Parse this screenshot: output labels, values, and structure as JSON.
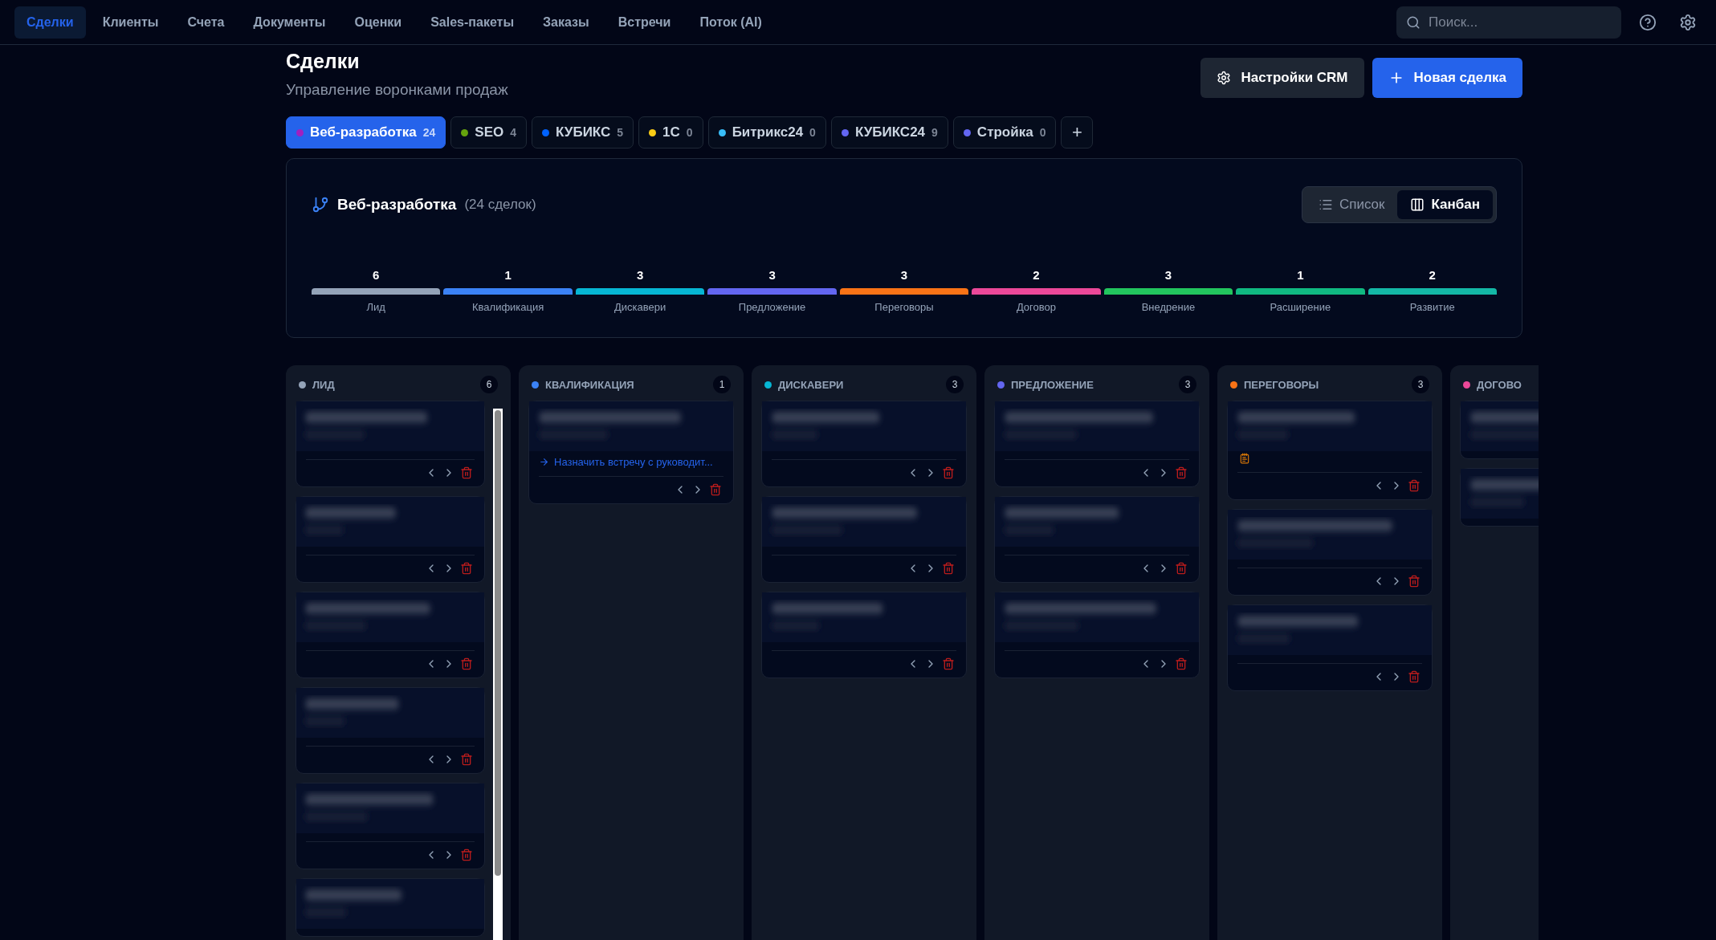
{
  "nav": {
    "items": [
      {
        "label": "Сделки",
        "selected": true
      },
      {
        "label": "Клиенты",
        "selected": false
      },
      {
        "label": "Счета",
        "selected": false
      },
      {
        "label": "Документы",
        "selected": false
      },
      {
        "label": "Оценки",
        "selected": false
      },
      {
        "label": "Sales-пакеты",
        "selected": false
      },
      {
        "label": "Заказы",
        "selected": false
      },
      {
        "label": "Встречи",
        "selected": false
      },
      {
        "label": "Поток (AI)",
        "selected": false
      }
    ],
    "search": {
      "placeholder": "Поиск..."
    }
  },
  "header": {
    "title": "Сделки",
    "subtitle": "Управление воронками продаж",
    "settings_button": "Настройки CRM",
    "new_button": "Новая сделка"
  },
  "pipelines": [
    {
      "label": "Веб-разработка",
      "count": "24",
      "color": "#a020c0",
      "selected": true
    },
    {
      "label": "SEO",
      "count": "4",
      "color": "#65a30d",
      "selected": false
    },
    {
      "label": "КУБИКС",
      "count": "5",
      "color": "#0062ff",
      "selected": false
    },
    {
      "label": "1С",
      "count": "0",
      "color": "#facc15",
      "selected": false
    },
    {
      "label": "Битрикс24",
      "count": "0",
      "color": "#38bdf8",
      "selected": false
    },
    {
      "label": "КУБИКС24",
      "count": "9",
      "color": "#6366f1",
      "selected": false
    },
    {
      "label": "Стройка",
      "count": "0",
      "color": "#6366f1",
      "selected": false
    }
  ],
  "add_pipeline": "+",
  "panel": {
    "title": "Веб-разработка",
    "subtitle": "(24 сделок)",
    "views": [
      {
        "label": "Список",
        "kind": "list",
        "selected": false
      },
      {
        "label": "Канбан",
        "kind": "kanban",
        "selected": true
      }
    ],
    "stages": [
      {
        "count": "6",
        "label": "Лид",
        "color": "#94a3b8"
      },
      {
        "count": "1",
        "label": "Квалификация",
        "color": "#3b82f6"
      },
      {
        "count": "3",
        "label": "Дискавери",
        "color": "#06b6d4"
      },
      {
        "count": "3",
        "label": "Предложение",
        "color": "#6366f1"
      },
      {
        "count": "3",
        "label": "Переговоры",
        "color": "#f97316"
      },
      {
        "count": "2",
        "label": "Договор",
        "color": "#ec4899"
      },
      {
        "count": "3",
        "label": "Внедрение",
        "color": "#22c55e"
      },
      {
        "count": "1",
        "label": "Расширение",
        "color": "#10b981"
      },
      {
        "count": "2",
        "label": "Развитие",
        "color": "#14b8a6"
      }
    ]
  },
  "columns": [
    {
      "title": "ЛИД",
      "count": "6",
      "color": "#94a3b8",
      "scrollbar": true,
      "cards": [
        {
          "document": false
        },
        {
          "document": false
        },
        {
          "document": false
        },
        {
          "document": false
        },
        {
          "document": false
        },
        {
          "document": false,
          "controls": false
        }
      ]
    },
    {
      "title": "КВАЛИФИКАЦИЯ",
      "count": "1",
      "color": "#3b82f6",
      "scrollbar": false,
      "cards": [
        {
          "document": false,
          "next_step": "Назначить встречу с руководит..."
        }
      ]
    },
    {
      "title": "ДИСКАВЕРИ",
      "count": "3",
      "color": "#06b6d4",
      "scrollbar": false,
      "cards": [
        {
          "document": false
        },
        {
          "document": false
        },
        {
          "document": false
        }
      ]
    },
    {
      "title": "ПРЕДЛОЖЕНИЕ",
      "count": "3",
      "color": "#6366f1",
      "scrollbar": false,
      "cards": [
        {
          "document": false
        },
        {
          "document": false
        },
        {
          "document": false
        }
      ]
    },
    {
      "title": "ПЕРЕГОВОРЫ",
      "count": "3",
      "color": "#f97316",
      "scrollbar": false,
      "cards": [
        {
          "document": true
        },
        {
          "document": false
        },
        {
          "document": false
        }
      ]
    },
    {
      "title": "ДОГОВО",
      "color": "#ec4899",
      "cards": [
        {
          "document": false,
          "controls": false
        },
        {
          "document": false,
          "controls": false
        }
      ]
    }
  ]
}
